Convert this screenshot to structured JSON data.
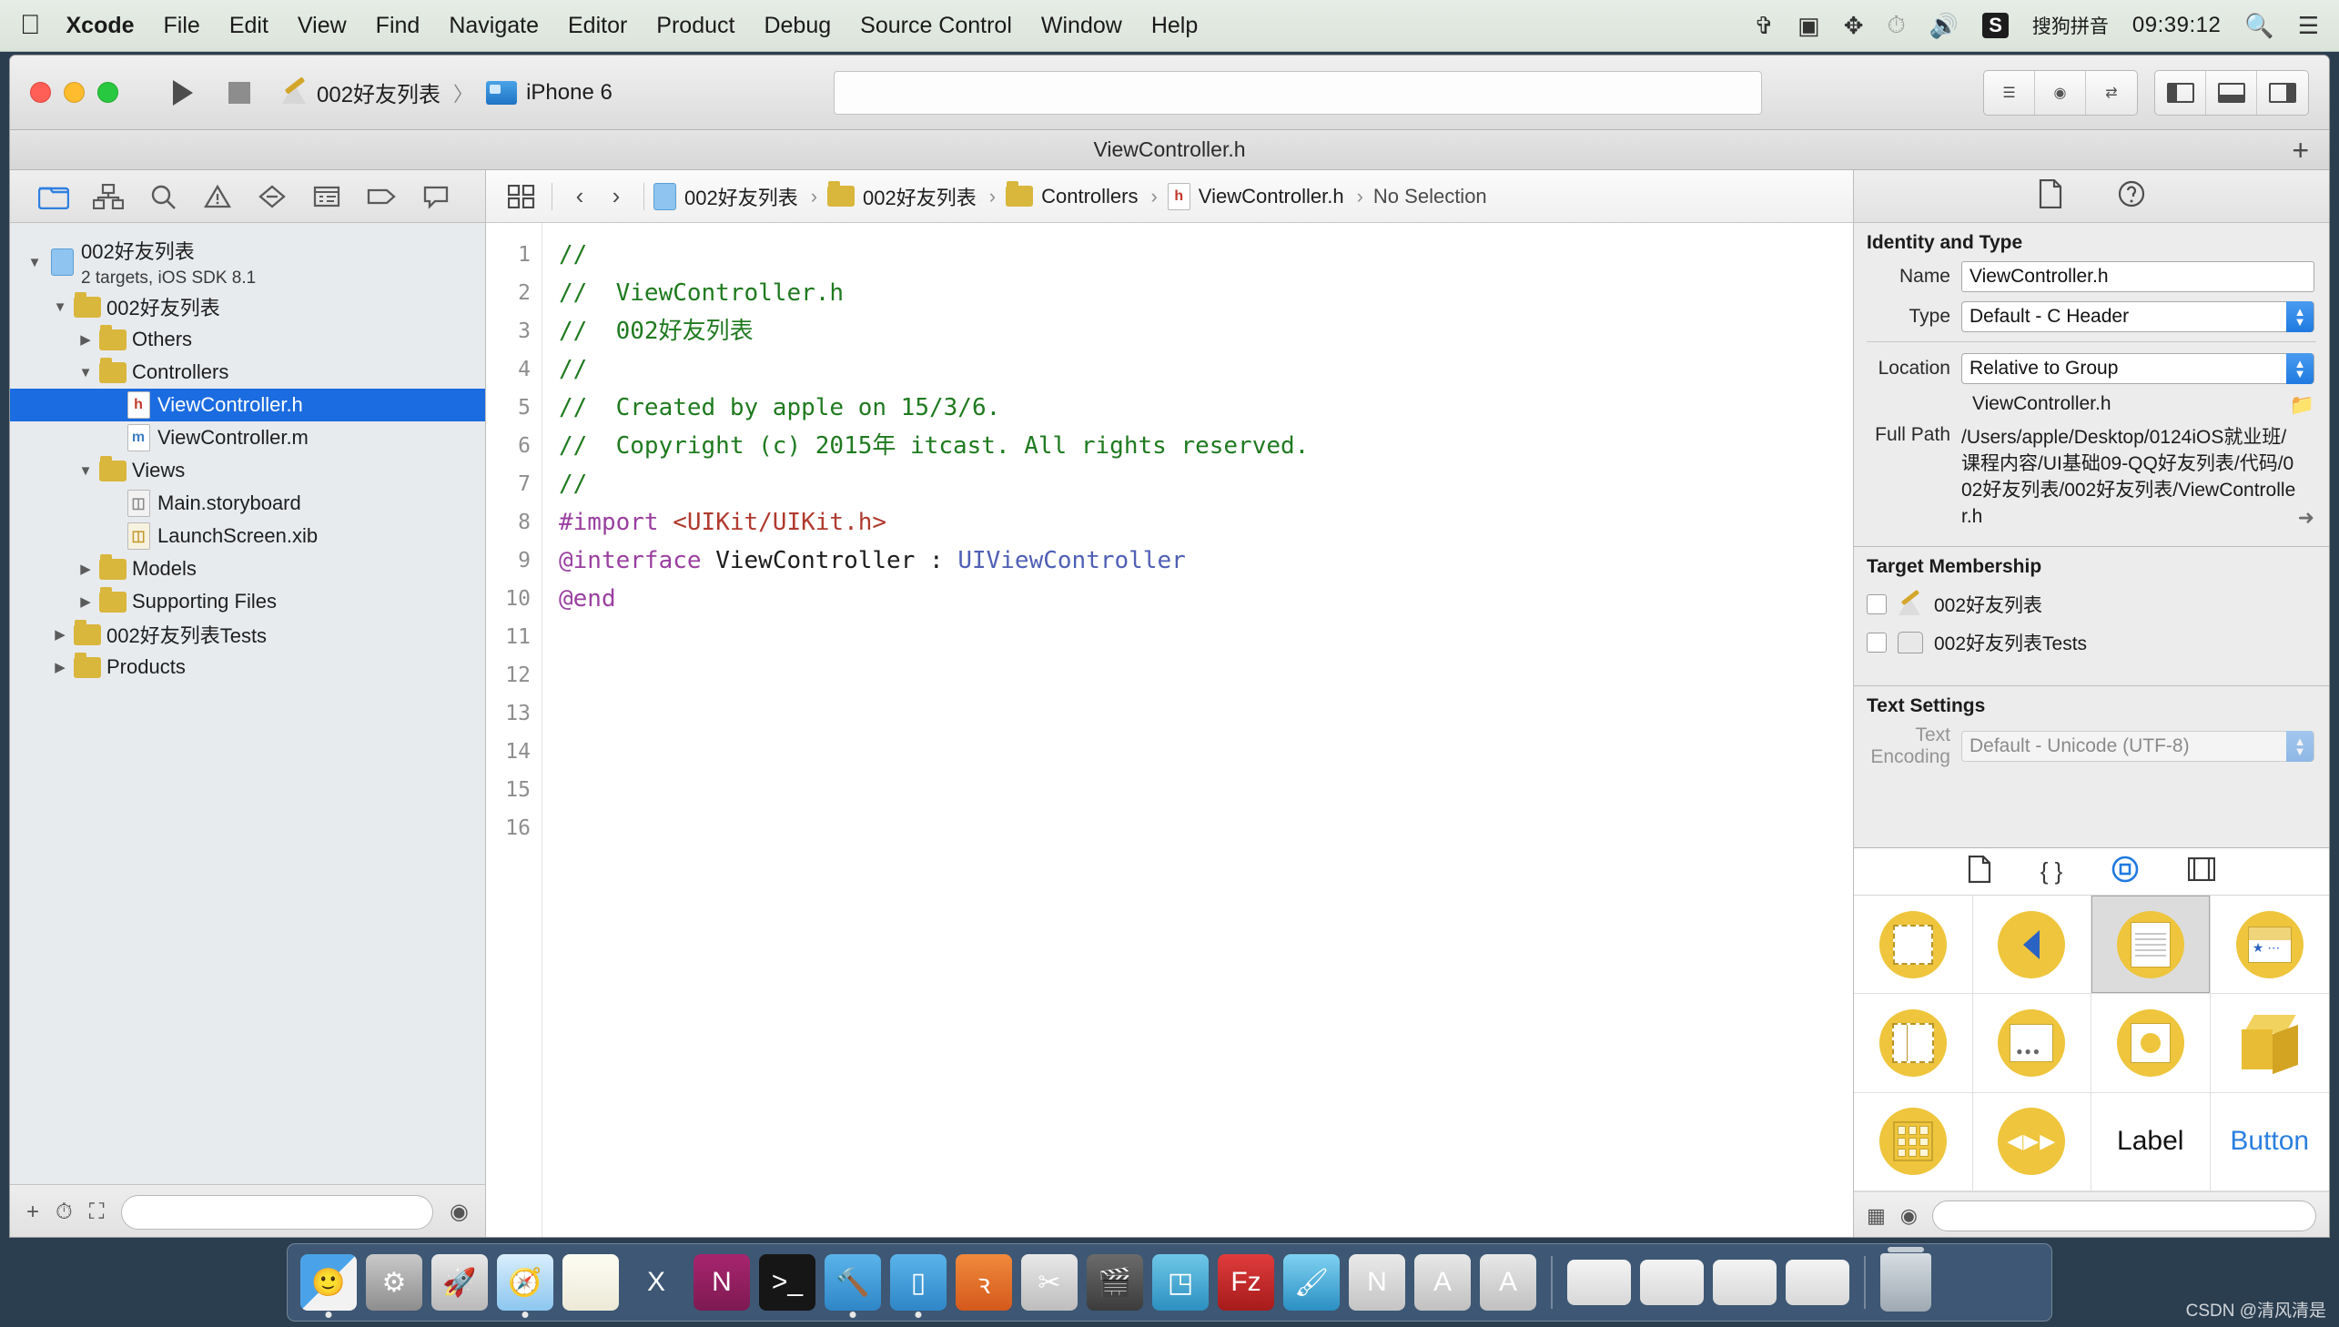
{
  "menubar": {
    "apple_icon": "apple-logo-icon",
    "items": [
      "Xcode",
      "File",
      "Edit",
      "View",
      "Find",
      "Navigate",
      "Editor",
      "Product",
      "Debug",
      "Source Control",
      "Window",
      "Help"
    ],
    "status_icons": [
      "bluetooth-icon",
      "screen-recording-icon",
      "airdrop-icon",
      "timemachine-icon",
      "volume-icon"
    ],
    "ime_badge": "S",
    "ime_name": "搜狗拼音",
    "clock": "09:39:12",
    "search_icon": "search-icon",
    "notification_icon": "notification-center-icon"
  },
  "toolbar": {
    "run_label": "run-button",
    "stop_label": "stop-button",
    "scheme_name": "002好友列表",
    "scheme_separator": "〉",
    "destination": "iPhone 6",
    "activity_placeholder": "",
    "editor_buttons": [
      "standard-editor",
      "assistant-editor",
      "version-editor"
    ],
    "view_buttons": [
      "toggle-navigator",
      "toggle-debug-area",
      "toggle-utilities"
    ]
  },
  "window": {
    "title": "ViewController.h",
    "add_tab_label": "+"
  },
  "navigator": {
    "tabs": [
      "project-navigator",
      "symbol-navigator",
      "find-navigator",
      "issue-navigator",
      "test-navigator",
      "debug-navigator",
      "breakpoint-navigator",
      "report-navigator"
    ],
    "active_tab": "project-navigator",
    "tree": [
      {
        "depth": 0,
        "twisty": "▼",
        "icon": "project-icon",
        "label": "002好友列表",
        "bold": true,
        "sub": "2 targets, iOS SDK 8.1",
        "selected": false
      },
      {
        "depth": 1,
        "twisty": "▼",
        "icon": "folder-icon",
        "label": "002好友列表",
        "bold": false,
        "selected": false
      },
      {
        "depth": 2,
        "twisty": "▶",
        "icon": "folder-icon",
        "label": "Others",
        "bold": false,
        "selected": false
      },
      {
        "depth": 2,
        "twisty": "▼",
        "icon": "folder-icon",
        "label": "Controllers",
        "bold": false,
        "selected": false
      },
      {
        "depth": 3,
        "twisty": "",
        "icon": "header-file-icon",
        "label": "ViewController.h",
        "bold": false,
        "selected": true
      },
      {
        "depth": 3,
        "twisty": "",
        "icon": "implementation-file-icon",
        "label": "ViewController.m",
        "bold": false,
        "selected": false
      },
      {
        "depth": 2,
        "twisty": "▼",
        "icon": "folder-icon",
        "label": "Views",
        "bold": false,
        "selected": false
      },
      {
        "depth": 3,
        "twisty": "",
        "icon": "storyboard-file-icon",
        "label": "Main.storyboard",
        "bold": false,
        "selected": false
      },
      {
        "depth": 3,
        "twisty": "",
        "icon": "xib-file-icon",
        "label": "LaunchScreen.xib",
        "bold": false,
        "selected": false
      },
      {
        "depth": 2,
        "twisty": "▶",
        "icon": "folder-icon",
        "label": "Models",
        "bold": false,
        "selected": false
      },
      {
        "depth": 2,
        "twisty": "▶",
        "icon": "folder-icon",
        "label": "Supporting Files",
        "bold": false,
        "selected": false
      },
      {
        "depth": 1,
        "twisty": "▶",
        "icon": "folder-icon",
        "label": "002好友列表Tests",
        "bold": false,
        "selected": false
      },
      {
        "depth": 1,
        "twisty": "▶",
        "icon": "folder-icon",
        "label": "Products",
        "bold": false,
        "selected": false
      }
    ],
    "footer": {
      "add_icon": "add-icon",
      "recent_icon": "recent-icon",
      "filter_icon": "filter-icon",
      "filter_placeholder": ""
    }
  },
  "editor": {
    "jumpbar": {
      "related_icon": "related-items-icon",
      "back_arrow": "‹",
      "forward_arrow": "›",
      "crumbs": [
        {
          "icon": "project-icon",
          "label": "002好友列表"
        },
        {
          "icon": "folder-icon",
          "label": "002好友列表"
        },
        {
          "icon": "folder-icon",
          "label": "Controllers"
        },
        {
          "icon": "header-file-icon",
          "label": "ViewController.h"
        },
        {
          "icon": "",
          "label": "No Selection"
        }
      ]
    },
    "line_numbers": [
      1,
      2,
      3,
      4,
      5,
      6,
      7,
      8,
      9,
      10,
      11,
      12,
      13,
      14,
      15,
      16
    ],
    "lines": [
      {
        "n": 1,
        "segments": [
          {
            "t": "//",
            "c": "comment"
          }
        ]
      },
      {
        "n": 2,
        "segments": [
          {
            "t": "//  ViewController.h",
            "c": "comment"
          }
        ]
      },
      {
        "n": 3,
        "segments": [
          {
            "t": "//  002好友列表",
            "c": "comment"
          }
        ]
      },
      {
        "n": 4,
        "segments": [
          {
            "t": "//",
            "c": "comment"
          }
        ]
      },
      {
        "n": 5,
        "segments": [
          {
            "t": "//  Created by apple on 15/3/6.",
            "c": "comment"
          }
        ]
      },
      {
        "n": 6,
        "segments": [
          {
            "t": "//  Copyright (c) 2015年 itcast. All rights reserved.",
            "c": "comment"
          }
        ]
      },
      {
        "n": 7,
        "segments": [
          {
            "t": "//",
            "c": "comment"
          }
        ]
      },
      {
        "n": 8,
        "segments": [
          {
            "t": "",
            "c": "plain"
          }
        ]
      },
      {
        "n": 9,
        "segments": [
          {
            "t": "#import ",
            "c": "pre"
          },
          {
            "t": "<UIKit/UIKit.h>",
            "c": "str"
          }
        ]
      },
      {
        "n": 10,
        "segments": [
          {
            "t": "",
            "c": "plain"
          }
        ]
      },
      {
        "n": 11,
        "segments": [
          {
            "t": "@interface",
            "c": "kw"
          },
          {
            "t": " ViewController : ",
            "c": "plain"
          },
          {
            "t": "UIViewController",
            "c": "type"
          }
        ]
      },
      {
        "n": 12,
        "segments": [
          {
            "t": "",
            "c": "plain"
          }
        ]
      },
      {
        "n": 13,
        "segments": [
          {
            "t": "",
            "c": "plain"
          }
        ]
      },
      {
        "n": 14,
        "segments": [
          {
            "t": "@end",
            "c": "kw"
          }
        ]
      },
      {
        "n": 15,
        "segments": [
          {
            "t": "",
            "c": "plain"
          }
        ]
      },
      {
        "n": 16,
        "segments": [
          {
            "t": "",
            "c": "plain"
          }
        ]
      }
    ]
  },
  "inspector": {
    "tabs": [
      "file-inspector",
      "quick-help-inspector"
    ],
    "active_tab": "file-inspector",
    "identity_and_type": {
      "section_title": "Identity and Type",
      "name_label": "Name",
      "name_value": "ViewController.h",
      "type_label": "Type",
      "type_value": "Default - C Header",
      "location_label": "Location",
      "location_value": "Relative to Group",
      "location_file": "ViewController.h",
      "choose_icon": "choose-folder-icon",
      "full_path_label": "Full Path",
      "full_path_value": "/Users/apple/Desktop/0124iOS就业班/课程内容/UI基础09-QQ好友列表/代码/002好友列表/002好友列表/ViewController.h",
      "reveal_icon": "reveal-in-finder-icon"
    },
    "target_membership": {
      "section_title": "Target Membership",
      "items": [
        {
          "label": "002好友列表",
          "icon": "app-target-icon",
          "checked": false
        },
        {
          "label": "002好友列表Tests",
          "icon": "test-target-icon",
          "checked": false
        }
      ]
    },
    "text_settings": {
      "section_title": "Text Settings",
      "encoding_label": "Text Encoding",
      "encoding_value": "Default - Unicode (UTF-8)"
    }
  },
  "library": {
    "tabs": [
      "file-template-library",
      "code-snippet-library",
      "object-library",
      "media-library"
    ],
    "active_tab": "object-library",
    "items": [
      {
        "name": "view-controller",
        "kind": "glyph",
        "glyph": "dashed-square"
      },
      {
        "name": "navigation-controller",
        "kind": "glyph",
        "glyph": "chevron-left"
      },
      {
        "name": "table-view-controller",
        "kind": "glyph",
        "glyph": "lined-page",
        "selected": true
      },
      {
        "name": "tab-bar-controller",
        "kind": "glyph",
        "glyph": "nav-bar-star"
      },
      {
        "name": "split-view-controller",
        "kind": "glyph",
        "glyph": "split-rect"
      },
      {
        "name": "page-view-controller",
        "kind": "glyph",
        "glyph": "tab-rect"
      },
      {
        "name": "glkit-view-controller",
        "kind": "glyph",
        "glyph": "page-circle"
      },
      {
        "name": "object-cube",
        "kind": "glyph",
        "glyph": "cube"
      },
      {
        "name": "collection-view-controller",
        "kind": "glyph",
        "glyph": "grid-square"
      },
      {
        "name": "avkit-player-controller",
        "kind": "glyph",
        "glyph": "player"
      },
      {
        "name": "label",
        "kind": "text",
        "text": "Label"
      },
      {
        "name": "button",
        "kind": "text",
        "text": "Button",
        "blue": true
      }
    ],
    "footer": {
      "mode_icon": "grid-mode-icon",
      "filter_icon": "filter-icon",
      "search_placeholder": ""
    }
  },
  "dock": {
    "items": [
      {
        "name": "finder",
        "glyph": "🙂",
        "bg": "linear-gradient(135deg,#4aa3e8 50%, #f2f2f2 50%)",
        "running": true
      },
      {
        "name": "system-preferences",
        "glyph": "⚙",
        "bg": "linear-gradient(#c9c9c9,#8d8d8d)",
        "running": false
      },
      {
        "name": "launchpad",
        "glyph": "🚀",
        "bg": "linear-gradient(#e8e8e8,#b9b9b9)",
        "running": false
      },
      {
        "name": "safari",
        "glyph": "🧭",
        "bg": "linear-gradient(#d9eefc,#8cc6ef)",
        "running": true
      },
      {
        "name": "notes",
        "glyph": "",
        "bg": "linear-gradient(#fdfdf2,#ece9d8)",
        "running": false
      },
      {
        "name": "microsoft-excel",
        "glyph": "X",
        "bg": "transparent",
        "running": false
      },
      {
        "name": "onenote",
        "glyph": "N",
        "bg": "linear-gradient(#a8256e,#7d1a52)",
        "running": false
      },
      {
        "name": "terminal",
        "glyph": ">_",
        "bg": "#161616",
        "running": false
      },
      {
        "name": "xcode",
        "glyph": "🔨",
        "bg": "linear-gradient(#5ab4ea,#2f86c7)",
        "running": true
      },
      {
        "name": "simulator",
        "glyph": "▯",
        "bg": "linear-gradient(#5ab4ea,#2f86c7)",
        "running": true
      },
      {
        "name": "reeder",
        "glyph": "ꝛ",
        "bg": "linear-gradient(#f08a3c,#d4591c)",
        "running": false
      },
      {
        "name": "snipping-tool",
        "glyph": "✂",
        "bg": "linear-gradient(#e8e8e8,#bdbdbd)",
        "running": false
      },
      {
        "name": "imovie",
        "glyph": "🎬",
        "bg": "linear-gradient(#6b6b6b,#3c3c3c)",
        "running": false
      },
      {
        "name": "keynote",
        "glyph": "◳",
        "bg": "linear-gradient(#6fc7e8,#2c8fc0)",
        "running": false
      },
      {
        "name": "filezilla",
        "glyph": "Fz",
        "bg": "linear-gradient(#e03c3c,#a61b1b)",
        "running": false
      },
      {
        "name": "photoshop",
        "glyph": "🖌",
        "bg": "linear-gradient(#7fd2f2,#2a8fc2)",
        "running": false
      },
      {
        "name": "evernote",
        "glyph": "N",
        "bg": "linear-gradient(#eaeaea,#c4c4c4)",
        "running": false
      },
      {
        "name": "xcode-beta",
        "glyph": "A",
        "bg": "linear-gradient(#e8e8e8,#c0c0c0)",
        "running": false
      },
      {
        "name": "xcode-alt",
        "glyph": "A",
        "bg": "linear-gradient(#e8e8e8,#c0c0c0)",
        "running": false
      }
    ],
    "recent": [
      {
        "name": "recent-window-1"
      },
      {
        "name": "recent-window-2"
      },
      {
        "name": "recent-window-3"
      },
      {
        "name": "recent-window-4"
      }
    ],
    "trash_label": "trash"
  },
  "watermark": "CSDN @清风清是"
}
